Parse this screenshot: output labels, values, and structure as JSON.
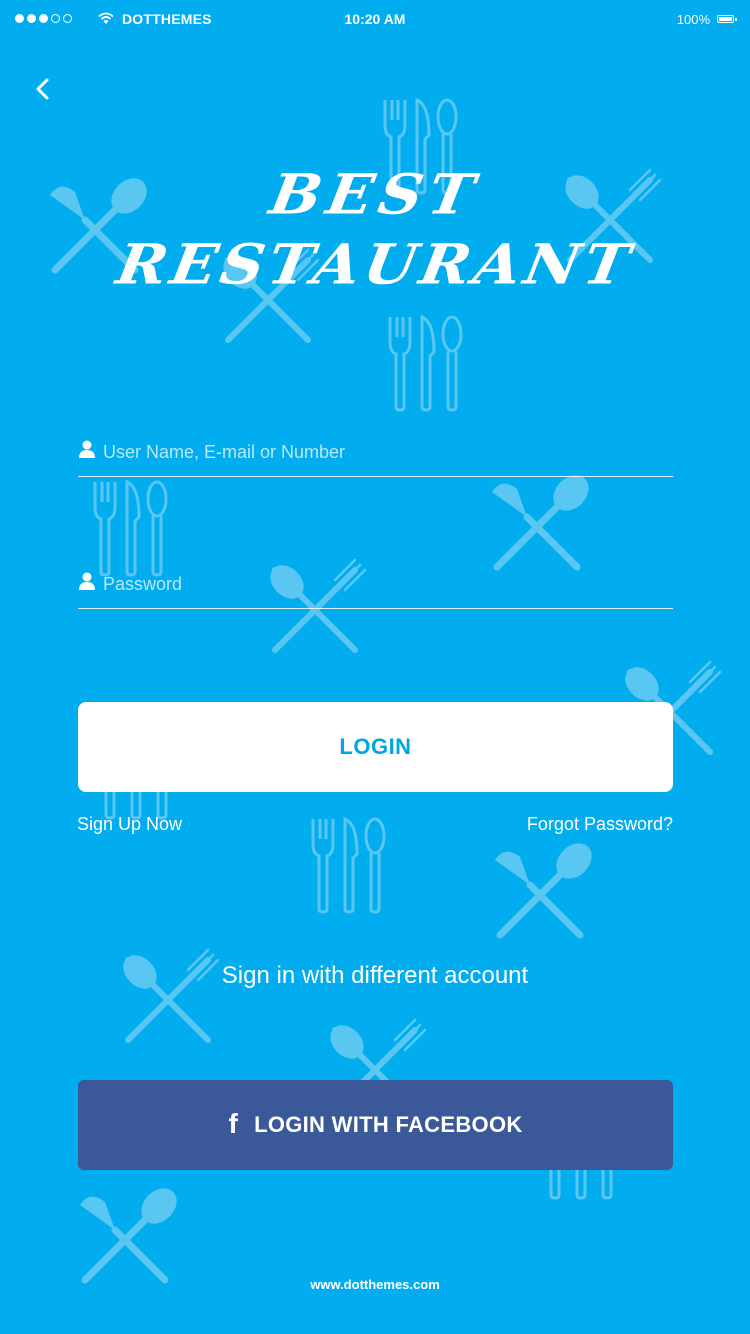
{
  "status_bar": {
    "carrier": "DOTTHEMES",
    "time": "10:20 AM",
    "battery": "100%",
    "signal_bars_filled": 3,
    "signal_bars_total": 5
  },
  "brand": {
    "line1": "BEST",
    "line2": "RESTAURANT"
  },
  "form": {
    "username_placeholder": "User Name, E-mail or Number",
    "username_value": "",
    "password_placeholder": "Password",
    "password_value": ""
  },
  "login_button_label": "LOGIN",
  "links": {
    "sign_up": "Sign Up Now",
    "forgot_password": "Forgot Password?"
  },
  "alt_signin_title": "Sign in with different account",
  "facebook_button_label": "LOGIN WITH FACEBOOK",
  "footer_url": "www.dotthemes.com",
  "icons": {
    "back": "chevron-left-icon",
    "user": "user-icon",
    "facebook": "facebook-icon",
    "wifi": "wifi-icon",
    "battery": "battery-icon"
  },
  "colors": {
    "background": "#01adef",
    "login_button_bg": "#ffffff",
    "login_button_text": "#01a5e4",
    "facebook_blue": "#3b5998",
    "pattern": "#4dc2f2"
  }
}
